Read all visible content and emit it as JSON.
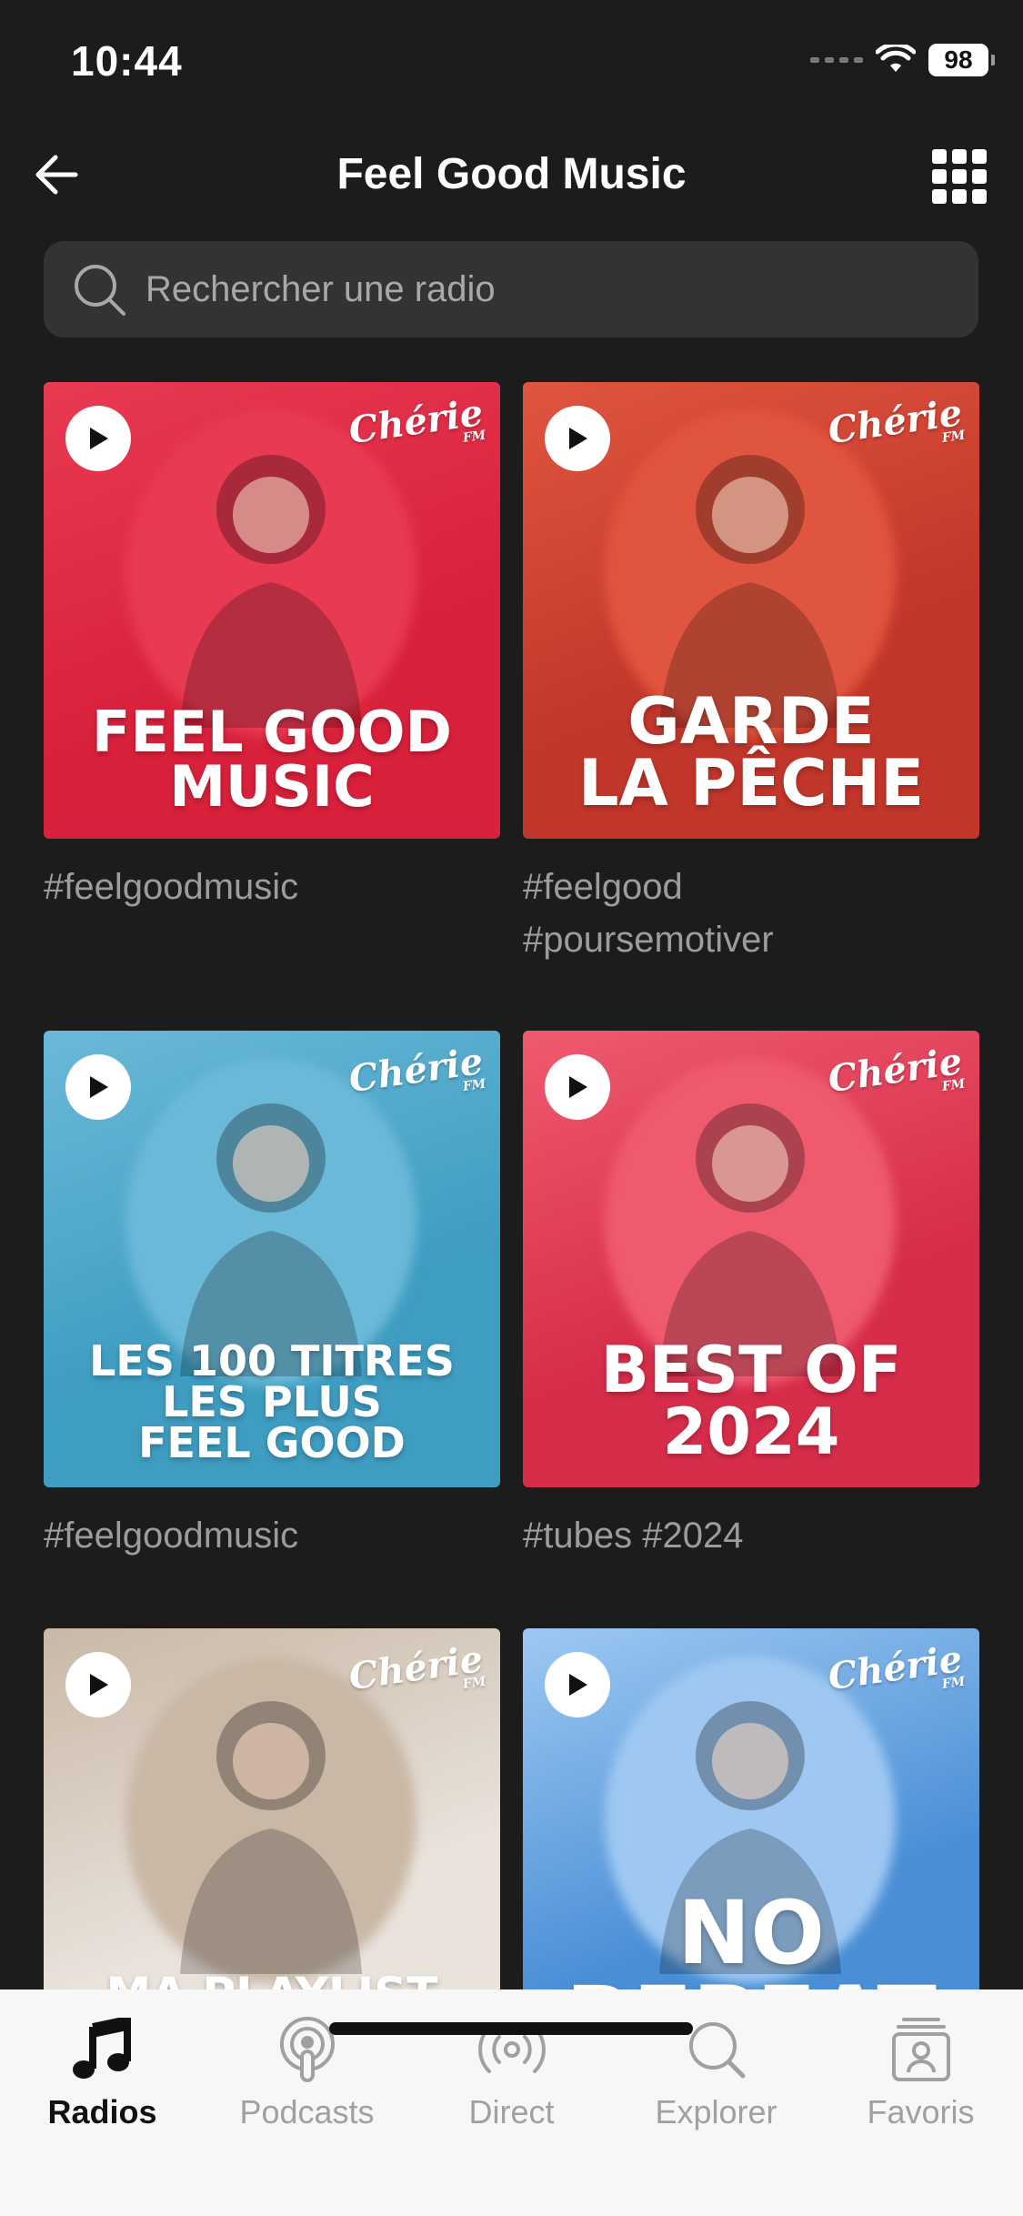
{
  "status": {
    "time": "10:44",
    "battery": "98"
  },
  "header": {
    "title": "Feel Good Music"
  },
  "search": {
    "placeholder": "Rechercher une radio"
  },
  "brand": "Chérie",
  "brand_sub": "FM",
  "cards": [
    {
      "title": "FEEL GOOD\nMUSIC",
      "tags": "#feelgoodmusic",
      "bg": "#d9213b",
      "accent": "#e83a52"
    },
    {
      "title": "GARDE\nLA PÊCHE",
      "tags": "#feelgood\n#poursemotiver",
      "bg": "#c2362b",
      "accent": "#e0553f"
    },
    {
      "title": "LES 100 TITRES\nLES PLUS\nFEEL GOOD",
      "tags": "#feelgoodmusic",
      "bg": "#3f9dc1",
      "accent": "#6bb9d8"
    },
    {
      "title": "BEST OF\n2024",
      "tags": "#tubes #2024",
      "bg": "#d62d4a",
      "accent": "#ef5a6f"
    },
    {
      "title": "MA PLAYLIST\nFEEL GOOD",
      "tags": "",
      "bg": "#e9e3dc",
      "accent": "#c9b8a6"
    },
    {
      "title": "NO\nREPEAT",
      "tags": "",
      "bg": "#4a8fd6",
      "accent": "#9ec8f2"
    }
  ],
  "tabs": [
    {
      "label": "Radios",
      "icon": "music-note-icon",
      "active": true
    },
    {
      "label": "Podcasts",
      "icon": "podcast-icon",
      "active": false
    },
    {
      "label": "Direct",
      "icon": "broadcast-icon",
      "active": false
    },
    {
      "label": "Explorer",
      "icon": "search-icon",
      "active": false
    },
    {
      "label": "Favoris",
      "icon": "favorites-icon",
      "active": false
    }
  ],
  "colors": {
    "background": "#1c1c1c",
    "tab_active": "#111111",
    "tab_inactive": "#a0a0a0"
  }
}
